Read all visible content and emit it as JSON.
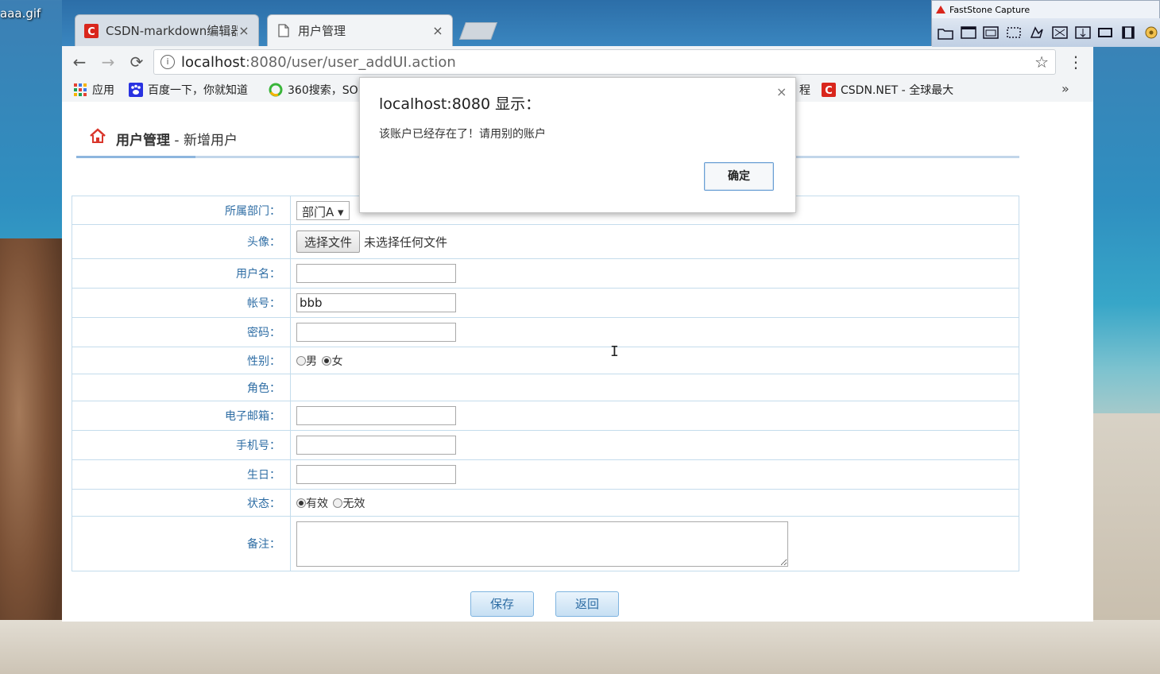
{
  "desktop": {
    "file_label": "aaa.gif"
  },
  "browser": {
    "tabs": [
      {
        "title": "CSDN-markdown编辑器",
        "close": "×",
        "active": false,
        "icon": "csdn-icon"
      },
      {
        "title": "用户管理",
        "close": "×",
        "active": true,
        "icon": "page-icon"
      }
    ],
    "nav": {
      "back": "←",
      "forward": "→",
      "reload": "⟳",
      "info": "i",
      "star": "☆",
      "menu": "⋮"
    },
    "address": {
      "host": "localhost",
      "path": ":8080/user/user_addUI.action"
    },
    "bookmarks": [
      {
        "label": "应用",
        "icon": "apps-grid-icon"
      },
      {
        "label": "百度一下，你就知道",
        "icon": "baidu-paw-icon"
      },
      {
        "label": "360搜索，SO",
        "icon": "so360-icon"
      },
      {
        "label": "程",
        "icon": ""
      },
      {
        "label": "CSDN.NET - 全球最大",
        "icon": "csdn-icon"
      }
    ],
    "bookmarks_more": "»"
  },
  "page": {
    "header_title": "用户管理",
    "header_sub": " - 新增用户",
    "form": {
      "department_label": "所属部门：",
      "department_value": "部门A ▾",
      "avatar_label": "头像：",
      "file_button": "选择文件",
      "file_status": "未选择任何文件",
      "username_label": "用户名：",
      "username_value": "",
      "account_label": "帐号：",
      "account_value": "bbb",
      "password_label": "密码：",
      "password_value": "",
      "gender_label": "性别：",
      "gender_options": [
        "男",
        "女"
      ],
      "gender_selected": "女",
      "role_label": "角色：",
      "email_label": "电子邮箱：",
      "email_value": "",
      "phone_label": "手机号：",
      "phone_value": "",
      "birthday_label": "生日：",
      "birthday_value": "",
      "status_label": "状态：",
      "status_options": [
        "有效",
        "无效"
      ],
      "status_selected": "有效",
      "remark_label": "备注："
    },
    "buttons": {
      "save": "保存",
      "back": "返回"
    }
  },
  "dialog": {
    "title": "localhost:8080 显示：",
    "message": "该账户已经存在了！请用别的账户",
    "ok": "确定",
    "close": "×"
  },
  "faststone": {
    "title": "FastStone Capture",
    "tools": [
      "open-icon",
      "capture-window-icon",
      "capture-object-icon",
      "capture-region-icon",
      "capture-freehand-icon",
      "capture-fullscreen-icon",
      "capture-scrolling-icon",
      "capture-fixed-icon",
      "record-video-icon",
      "settings-icon"
    ]
  },
  "colors": {
    "label_blue": "#2e6da4",
    "border_blue": "#c4dcec",
    "csdn_red": "#d9261c"
  }
}
